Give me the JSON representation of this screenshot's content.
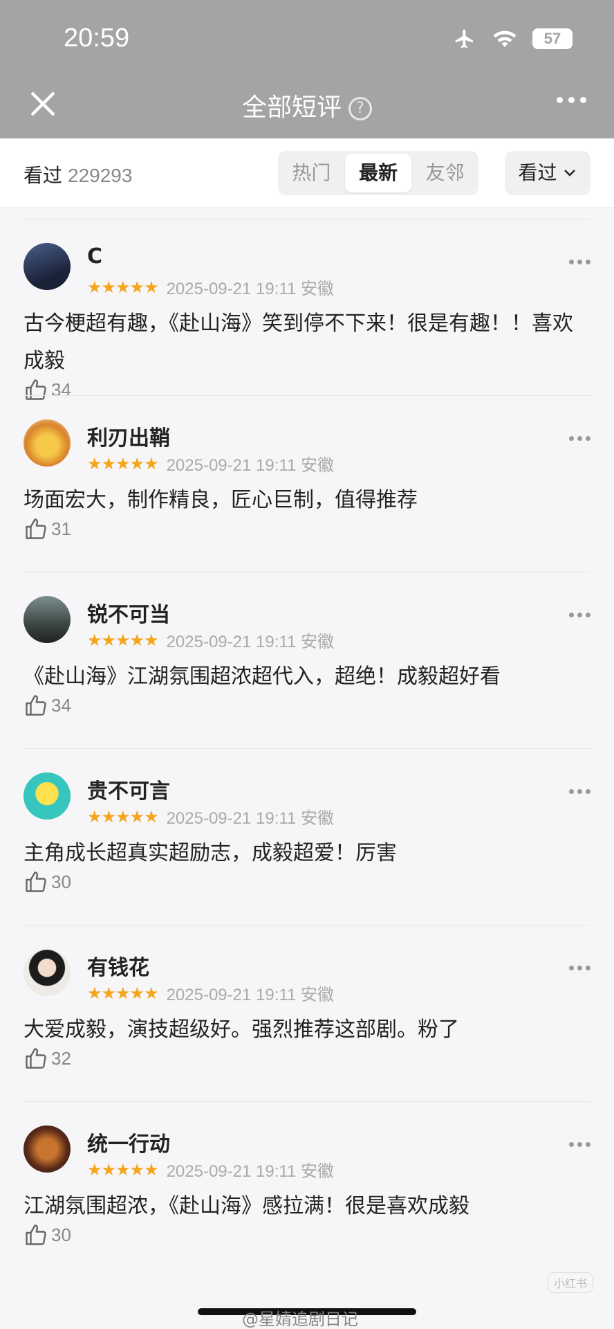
{
  "status": {
    "time": "20:59",
    "battery": "57"
  },
  "nav": {
    "title": "全部短评",
    "help": "?"
  },
  "filter": {
    "seen_label": "看过",
    "seen_count": "229293",
    "tabs": [
      "热门",
      "最新",
      "友邻"
    ],
    "active_tab": "最新",
    "dropdown_label": "看过"
  },
  "reviews": [
    {
      "user": "C",
      "stars": "★★★★★",
      "date": "2025-09-21 19:11 安徽",
      "content": "古今梗超有趣，《赴山海》笑到停不下来！很是有趣！！喜欢成毅",
      "likes": "34",
      "avatar_color": "#2e3a5a"
    },
    {
      "user": "利刃出鞘",
      "stars": "★★★★★",
      "date": "2025-09-21 19:11 安徽",
      "content": "场面宏大，制作精良，匠心巨制，值得推荐",
      "likes": "31",
      "avatar_color": "#e3a22b"
    },
    {
      "user": "锐不可当",
      "stars": "★★★★★",
      "date": "2025-09-21 19:11 安徽",
      "content": "《赴山海》江湖氛围超浓超代入，超绝！成毅超好看",
      "likes": "34",
      "avatar_color": "#5a6b68"
    },
    {
      "user": "贵不可言",
      "stars": "★★★★★",
      "date": "2025-09-21 19:11 安徽",
      "content": "主角成长超真实超励志，成毅超爱！厉害",
      "likes": "30",
      "avatar_color": "#3ec8c0"
    },
    {
      "user": "有钱花",
      "stars": "★★★★★",
      "date": "2025-09-21 19:11 安徽",
      "content": "大爱成毅，演技超级好。强烈推荐这部剧。粉了",
      "likes": "32",
      "avatar_color": "#d9d4cf"
    },
    {
      "user": "统一行动",
      "stars": "★★★★★",
      "date": "2025-09-21 19:11 安徽",
      "content": "江湖氛围超浓，《赴山海》感拉满！很是喜欢成毅",
      "likes": "30",
      "avatar_color": "#8a4a2a"
    }
  ],
  "watermark": "@星婧追剧日记",
  "corner_tag": "小红书"
}
